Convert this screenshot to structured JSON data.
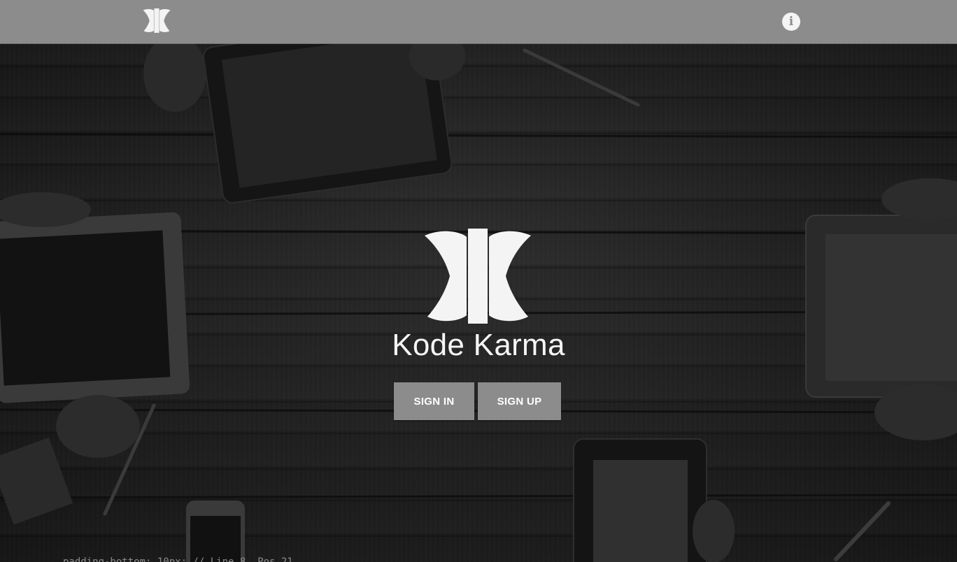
{
  "header": {
    "logo_icon": "kode-karma-logo-icon",
    "info_icon": "info-icon",
    "info_glyph": "i",
    "background_color": "#8c8c8c"
  },
  "hero": {
    "logo_icon": "kode-karma-logo-icon",
    "brand_name": "Kode Karma"
  },
  "actions": {
    "sign_in_label": "SIGN IN",
    "sign_up_label": "SIGN UP",
    "button_color": "#8c8c8c"
  },
  "footer": {
    "code_fragment": "padding-bottom: 10px; // Line 8, Pos 21"
  }
}
